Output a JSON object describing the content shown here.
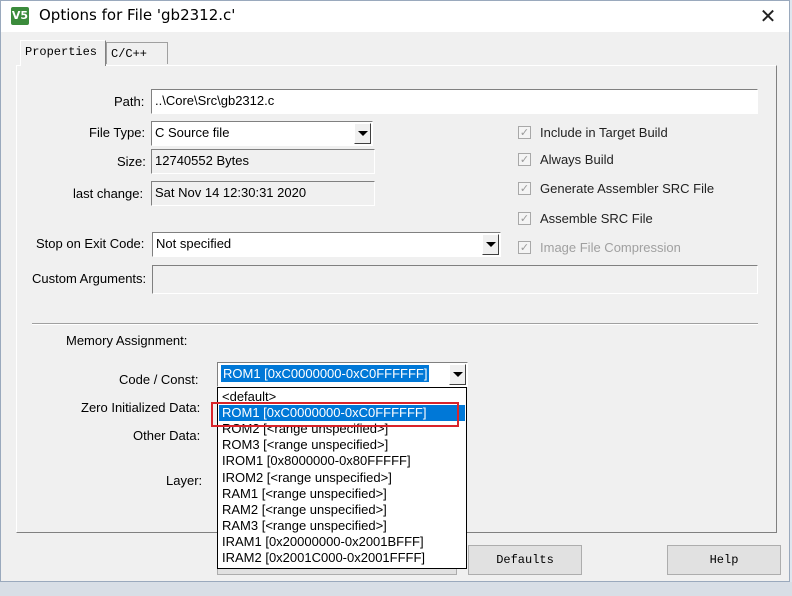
{
  "window": {
    "title": "Options for File 'gb2312.c'",
    "icon_glyph": "V5",
    "close_glyph": "✕"
  },
  "tabs": [
    {
      "label": "Properties",
      "active": true
    },
    {
      "label": "C/C++",
      "active": false
    }
  ],
  "properties": {
    "path_label": "Path:",
    "path_value": "..\\Core\\Src\\gb2312.c",
    "file_type_label": "File Type:",
    "file_type_value": "C Source file",
    "size_label": "Size:",
    "size_value": "12740552 Bytes",
    "last_change_label": "last change:",
    "last_change_value": "Sat Nov 14 12:30:31 2020",
    "stop_on_exit_label": "Stop on Exit Code:",
    "stop_on_exit_value": "Not specified",
    "custom_args_label": "Custom Arguments:",
    "custom_args_value": ""
  },
  "checkboxes": [
    {
      "label": "Include in Target Build",
      "checked": true,
      "disabled": false
    },
    {
      "label": "Always Build",
      "checked": true,
      "disabled": false
    },
    {
      "label": "Generate Assembler SRC File",
      "checked": true,
      "disabled": false
    },
    {
      "label": "Assemble SRC File",
      "checked": true,
      "disabled": false
    },
    {
      "label": "Image File Compression",
      "checked": true,
      "disabled": true
    }
  ],
  "memory": {
    "section_label": "Memory Assignment:",
    "code_const_label": "Code / Const:",
    "code_const_value": "ROM1 [0xC0000000-0xC0FFFFFF]",
    "zero_init_label": "Zero Initialized Data:",
    "other_data_label": "Other Data:",
    "layer_label": "Layer:",
    "options": [
      "<default>",
      "ROM1 [0xC0000000-0xC0FFFFFF]",
      "ROM2 [<range unspecified>]",
      "ROM3 [<range unspecified>]",
      "IROM1 [0x8000000-0x80FFFFF]",
      "IROM2 [<range unspecified>]",
      "RAM1 [<range unspecified>]",
      "RAM2 [<range unspecified>]",
      "RAM3 [<range unspecified>]",
      "IRAM1 [0x20000000-0x2001BFFF]",
      "IRAM2 [0x2001C000-0x2001FFFF]"
    ],
    "selected_index": 1
  },
  "buttons": {
    "defaults": "Defaults",
    "help": "Help"
  },
  "colors": {
    "selection": "#0078d7",
    "highlight_box": "#d9242a"
  }
}
